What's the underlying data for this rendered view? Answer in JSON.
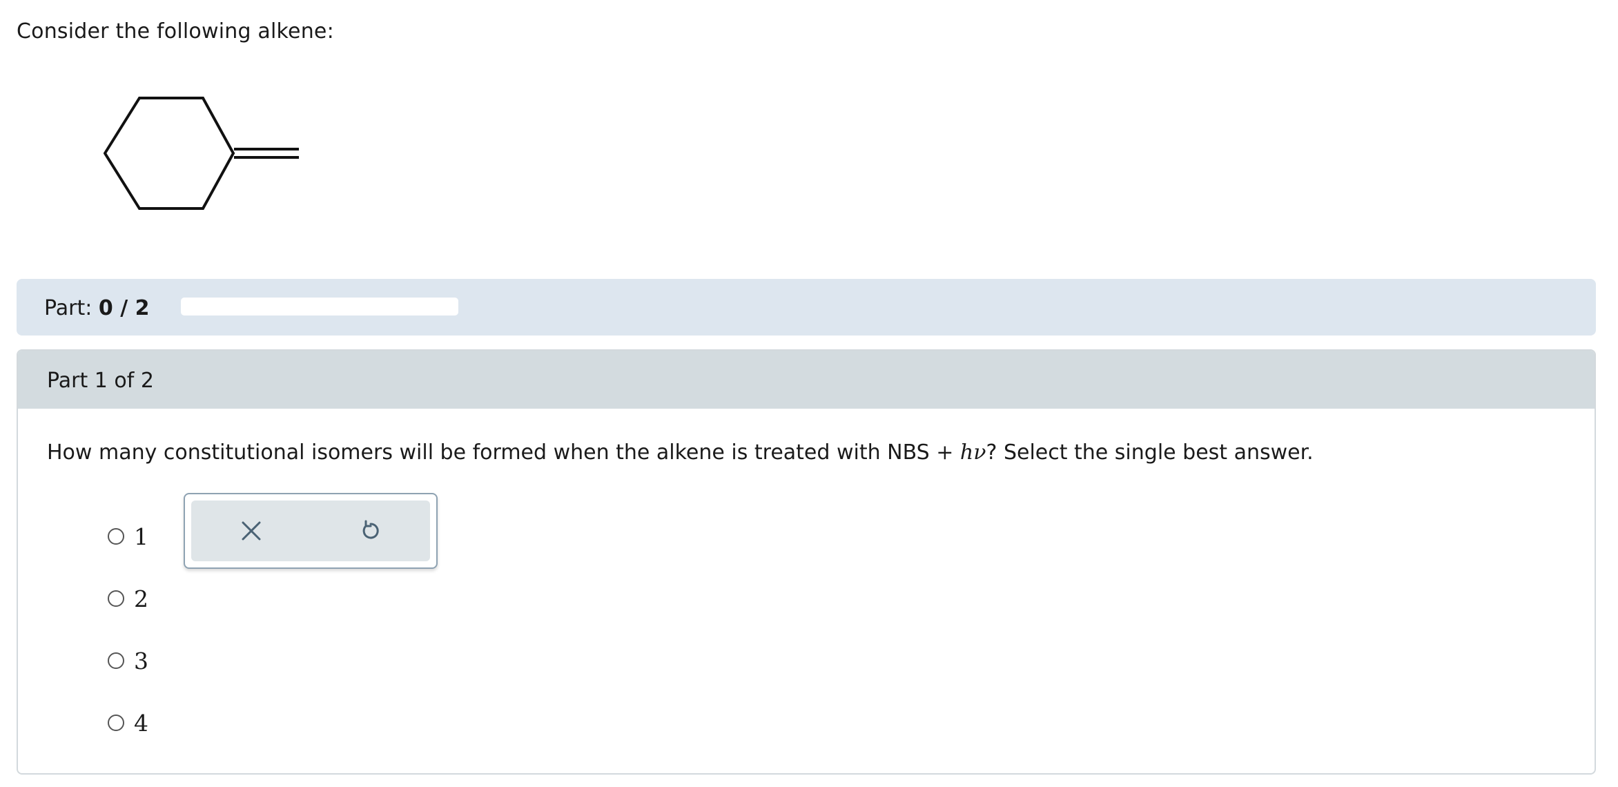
{
  "intro": "Consider the following alkene:",
  "progress": {
    "label_prefix": "Part: ",
    "value_text": "0 / 2",
    "fraction": 0
  },
  "part": {
    "header": "Part 1 of 2",
    "question_before": "How many constitutional isomers will be formed when the alkene is treated with NBS ",
    "question_plus": "+",
    "question_hv": "hν",
    "question_after": "? Select the single best answer."
  },
  "options": [
    "1",
    "2",
    "3",
    "4"
  ],
  "toolbar": {
    "clear_icon": "close-icon",
    "reset_icon": "undo-icon"
  },
  "colors": {
    "progress_strip_bg": "#dde6ef",
    "part_header_bg": "#d3dbdf",
    "toolbar_bg": "#dfe5e8",
    "icon_color": "#4a6274"
  }
}
